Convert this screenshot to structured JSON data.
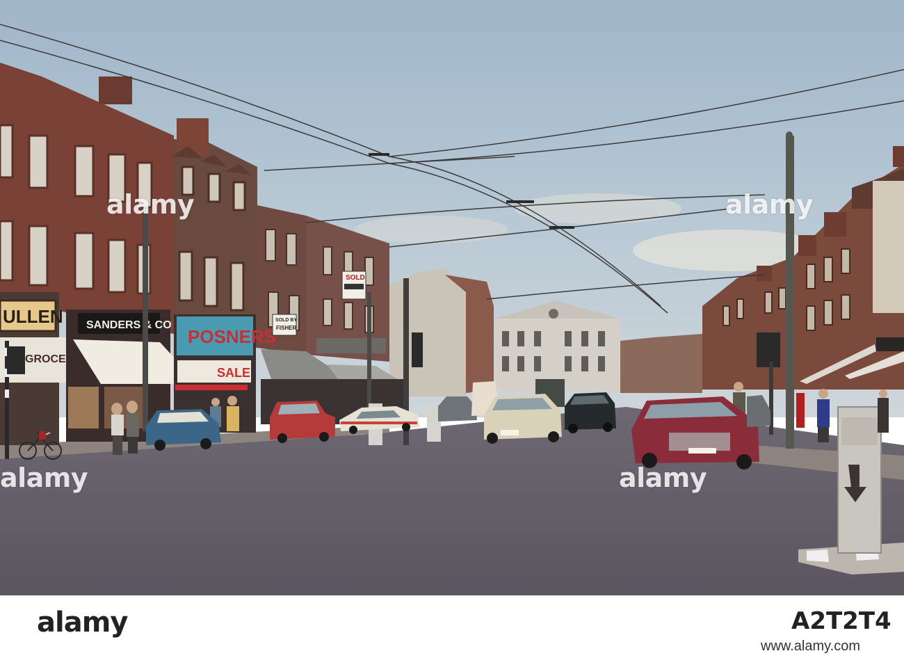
{
  "scene": {
    "signs": {
      "posners": "POSNERS",
      "sanders": "SANDERS & CO",
      "grocer": "GROCER",
      "ullen": "ULLEN",
      "sold_by": "SOLD BY",
      "fisher": "FISHER",
      "sold": "SOLD",
      "sale": "SALE"
    }
  },
  "watermark": {
    "text": "alamy"
  },
  "footer": {
    "brand": "alamy",
    "image_id": "A2T2T4",
    "url": "www.alamy.com"
  }
}
